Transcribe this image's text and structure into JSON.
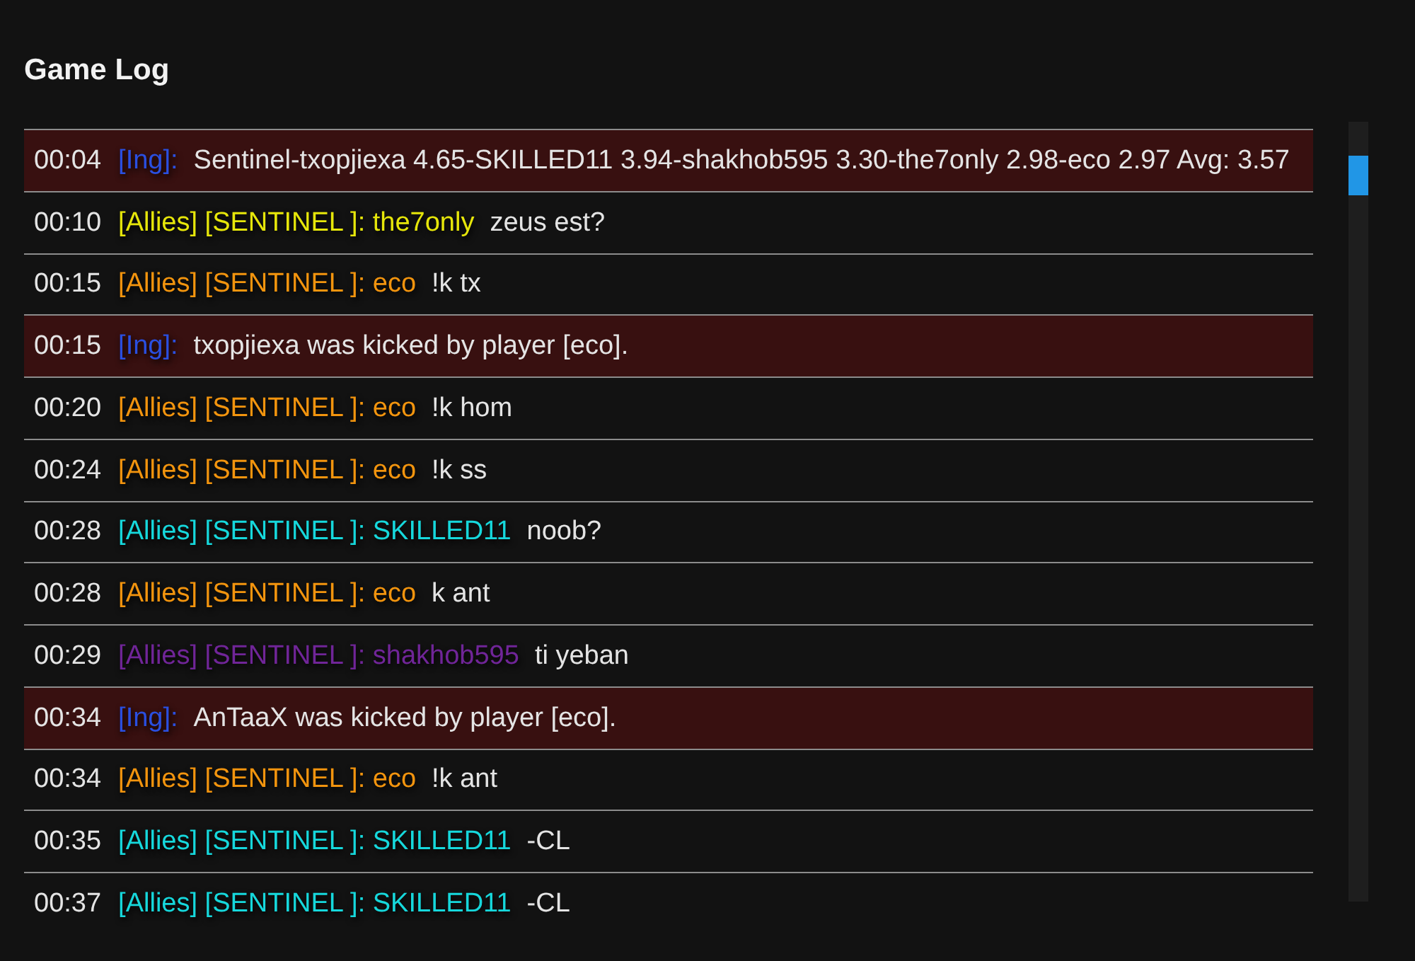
{
  "title": "Game Log",
  "rows": [
    {
      "kind": "system",
      "time": "00:04",
      "sender": "[Ing]:",
      "color": "#2a4fe0",
      "message": "Sentinel-txopjiexa 4.65-SKILLED11 3.94-shakhob595 3.30-the7only 2.98-eco 2.97 Avg: 3.57"
    },
    {
      "kind": "chat",
      "time": "00:10",
      "sender": "[Allies] [SENTINEL ]: the7only",
      "color": "#e6e60a",
      "message": "zeus est?"
    },
    {
      "kind": "chat",
      "time": "00:15",
      "sender": "[Allies] [SENTINEL ]: eco",
      "color": "#f2940e",
      "message": "!k tx"
    },
    {
      "kind": "system",
      "time": "00:15",
      "sender": "[Ing]:",
      "color": "#2a4fe0",
      "message": "txopjiexa was kicked by player [eco]."
    },
    {
      "kind": "chat",
      "time": "00:20",
      "sender": "[Allies] [SENTINEL ]: eco",
      "color": "#f2940e",
      "message": "!k hom"
    },
    {
      "kind": "chat",
      "time": "00:24",
      "sender": "[Allies] [SENTINEL ]: eco",
      "color": "#f2940e",
      "message": "!k ss"
    },
    {
      "kind": "chat",
      "time": "00:28",
      "sender": "[Allies] [SENTINEL ]: SKILLED11",
      "color": "#16d8dc",
      "message": "noob?"
    },
    {
      "kind": "chat",
      "time": "00:28",
      "sender": "[Allies] [SENTINEL ]: eco",
      "color": "#f2940e",
      "message": "k ant"
    },
    {
      "kind": "chat",
      "time": "00:29",
      "sender": "[Allies] [SENTINEL ]: shakhob595",
      "color": "#702598",
      "message": "ti yeban"
    },
    {
      "kind": "system",
      "time": "00:34",
      "sender": "[Ing]:",
      "color": "#2a4fe0",
      "message": "AnTaaX was kicked by player [eco]."
    },
    {
      "kind": "chat",
      "time": "00:34",
      "sender": "[Allies] [SENTINEL ]: eco",
      "color": "#f2940e",
      "message": "!k ant"
    },
    {
      "kind": "chat",
      "time": "00:35",
      "sender": "[Allies] [SENTINEL ]: SKILLED11",
      "color": "#16d8dc",
      "message": "-CL"
    },
    {
      "kind": "chat",
      "time": "00:37",
      "sender": "[Allies] [SENTINEL ]: SKILLED11",
      "color": "#16d8dc",
      "message": "-CL"
    }
  ]
}
